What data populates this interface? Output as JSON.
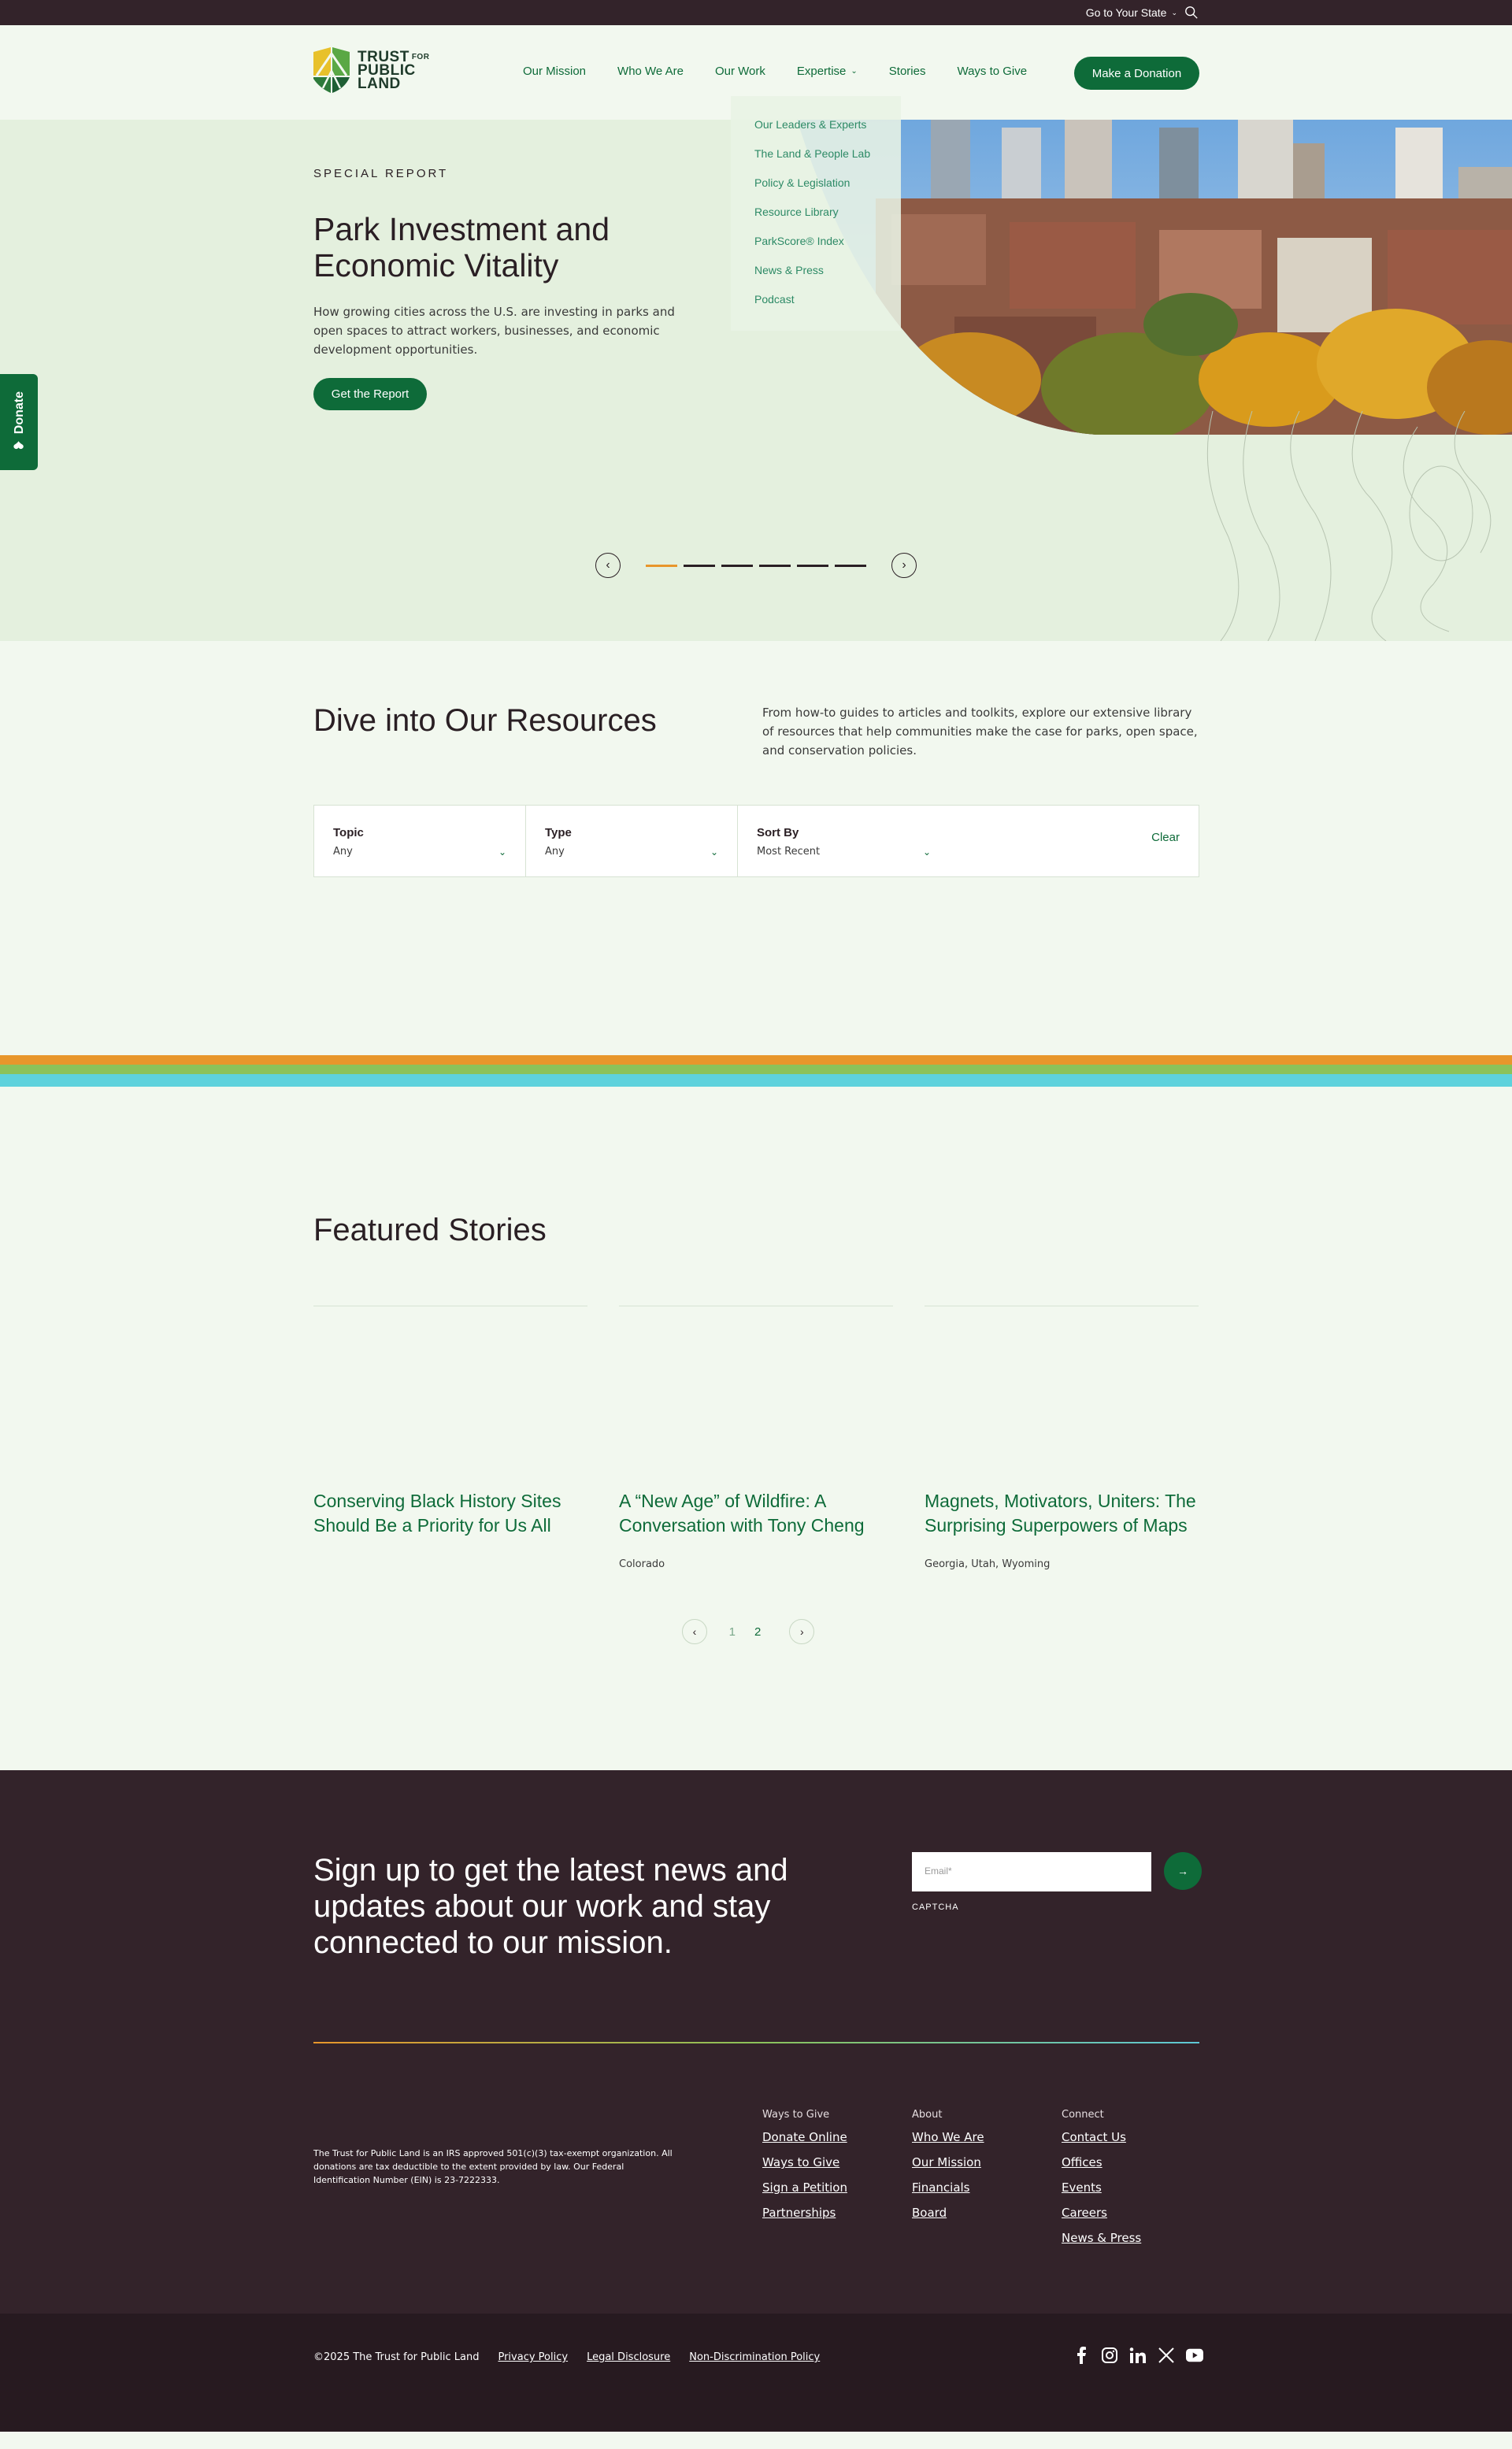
{
  "utility": {
    "state_label": "Go to Your State"
  },
  "brand": {
    "line1": "TRUST",
    "line1_small": "FOR",
    "line2": "PUBLIC",
    "line3": "LAND"
  },
  "nav": {
    "items": [
      "Our Mission",
      "Who We Are",
      "Our Work",
      "Expertise",
      "Stories",
      "Ways to Give"
    ],
    "donate": "Make a Donation"
  },
  "dropdown": {
    "items": [
      "Our Leaders & Experts",
      "The Land & People Lab",
      "Policy & Legislation",
      "Resource Library",
      "ParkScore® Index",
      "News & Press",
      "Podcast"
    ]
  },
  "hero": {
    "kicker": "SPECIAL REPORT",
    "title": "Park Investment and Economic Vitality",
    "description": "How growing cities across the U.S. are investing in parks and open spaces to attract workers, businesses, and economic development opportunities.",
    "cta": "Get the Report",
    "slides_count": 6,
    "active_slide": 1
  },
  "side_donate": "Donate",
  "resources": {
    "title": "Dive into Our Resources",
    "description": "From how-to guides to articles and toolkits, explore our extensive library of resources that help communities make the case for parks, open space, and conservation policies.",
    "filters": [
      {
        "label": "Topic",
        "value": "Any"
      },
      {
        "label": "Type",
        "value": "Any"
      },
      {
        "label": "Sort By",
        "value": "Most Recent"
      }
    ],
    "clear": "Clear"
  },
  "colors": {
    "stripe1": "#e8962b",
    "stripe2": "#8cc25a",
    "stripe3": "#5ed2dc",
    "brand_green": "#0e6b39",
    "dark": "#33232a"
  },
  "featured": {
    "title": "Featured Stories",
    "stories": [
      {
        "title": "Conserving Black History Sites Should Be a Priority for Us All",
        "meta": ""
      },
      {
        "title": "A “New Age” of Wildfire: A Conversation with Tony Cheng",
        "meta": "Colorado"
      },
      {
        "title": "Magnets, Motivators, Uniters: The Surprising Superpowers of Maps",
        "meta": "Georgia, Utah, Wyoming"
      }
    ],
    "pages": [
      "1",
      "2"
    ],
    "current_page": "2"
  },
  "footer": {
    "signup": "Sign up to get the latest news and updates about our work and stay connected to our mission.",
    "email_placeholder": "Email*",
    "captcha": "CAPTCHA",
    "legal": "The Trust for Public Land is an IRS approved 501(c)(3) tax-exempt organization. All donations are tax deductible to the extent provided by law. Our Federal Identification Number (EIN) is 23-7222333.",
    "columns": [
      {
        "head": "Ways to Give",
        "links": [
          "Donate Online",
          "Ways to Give",
          "Sign a Petition",
          "Partnerships"
        ]
      },
      {
        "head": "About",
        "links": [
          "Who We Are",
          "Our Mission",
          "Financials",
          "Board"
        ]
      },
      {
        "head": "Connect",
        "links": [
          "Contact Us",
          "Offices",
          "Events",
          "Careers",
          "News & Press"
        ]
      }
    ],
    "copyright": "©2025 The Trust for Public Land",
    "legal_links": [
      "Privacy Policy",
      "Legal Disclosure",
      "Non-Discrimination Policy"
    ],
    "socials": [
      "facebook-icon",
      "instagram-icon",
      "linkedin-icon",
      "x-icon",
      "youtube-icon"
    ]
  }
}
